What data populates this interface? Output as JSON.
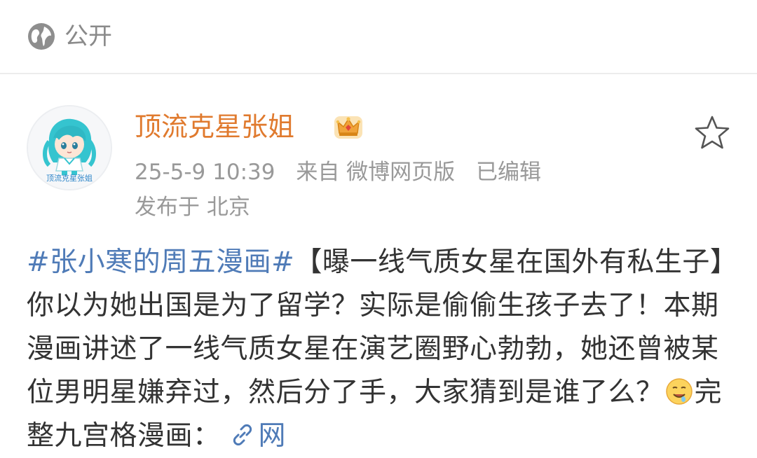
{
  "header": {
    "visibility_label": "公开",
    "visibility_icon": "globe-icon"
  },
  "author": {
    "name": "顶流克星张姐",
    "avatar_text": "顶流克星张姐",
    "badge_icon": "crown-icon",
    "name_color": "#e07a2e"
  },
  "meta": {
    "timestamp": "25-5-9 10:39",
    "source": "来自 微博网页版",
    "edited": "已编辑",
    "location": "发布于 北京"
  },
  "actions": {
    "favorite_icon": "star-icon"
  },
  "post": {
    "hashtag": "#张小寒的周五漫画#",
    "text": "【曝一线气质女星在国外有私生子】你以为她出国是为了留学？实际是偷偷生孩子去了！本期漫画讲述了一线气质女星在演艺圈野心勃勃，她还曾被某位男明星嫌弃过，然后分了手，大家猜到是谁了么？",
    "emoji_icon": "drooling-face-emoji",
    "text_after_emoji": "完整九宫格漫画：",
    "link_icon": "link-icon",
    "link_text": "网"
  },
  "colors": {
    "link": "#4f7bb7",
    "meta": "#999999",
    "body": "#333333"
  }
}
